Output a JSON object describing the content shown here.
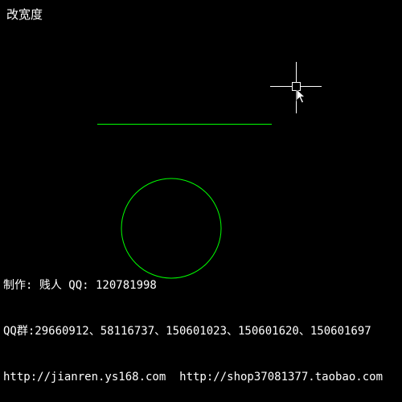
{
  "title": "改宽度",
  "colors": {
    "background": "#000000",
    "entity": "#00ff00",
    "text": "#ffffff",
    "crosshair": "#ffffff"
  },
  "cursor": {
    "icon": "crosshair-pickbox-icon",
    "pointer_icon": "arrow-pointer-icon"
  },
  "credits": {
    "line1": "制作: 贱人 QQ: 120781998",
    "line2": "QQ群:29660912、58116737、150601023、150601620、150601697",
    "line3": "http://jianren.ys168.com  http://shop37081377.taobao.com"
  }
}
